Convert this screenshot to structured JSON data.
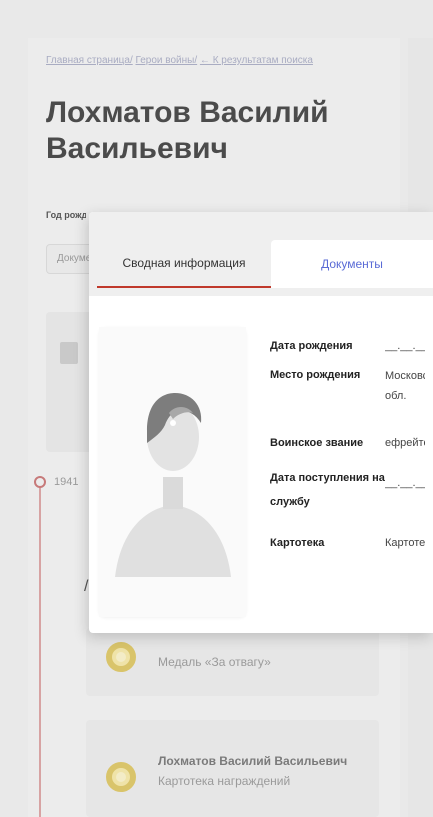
{
  "breadcrumb": {
    "home": "Главная страница/",
    "heroes": "Герои войны/",
    "back": "← К результатам поиска"
  },
  "person": {
    "title": "Лохматов Василий Васильевич",
    "birth_label": "Год рождения",
    "filter_pill": "Документы"
  },
  "timeline": {
    "year": "1941"
  },
  "awards": [
    {
      "title": "Медаль «За отвагу»"
    },
    {
      "name": "Лохматов Василий Васильевич",
      "subtitle": "Картотека награждений"
    }
  ],
  "modal": {
    "tabs": [
      {
        "label": "Сводная информация",
        "active": true
      },
      {
        "label": "Документы",
        "active": false
      }
    ],
    "fields": [
      {
        "label": "Дата рождения",
        "value": "__.__.____"
      },
      {
        "label": "Место рождения",
        "value": "Московская обл. Ста"
      },
      {
        "label": "Воинское звание",
        "value": "ефрейтор"
      },
      {
        "label": "Дата поступления на службу",
        "value": "__.__.____"
      },
      {
        "label": "Картотека",
        "value": "Картотека"
      }
    ]
  },
  "colors": {
    "accent_red": "#c0392b",
    "link_blue": "#5a6bd6",
    "medal_gold": "#d9c46a"
  }
}
